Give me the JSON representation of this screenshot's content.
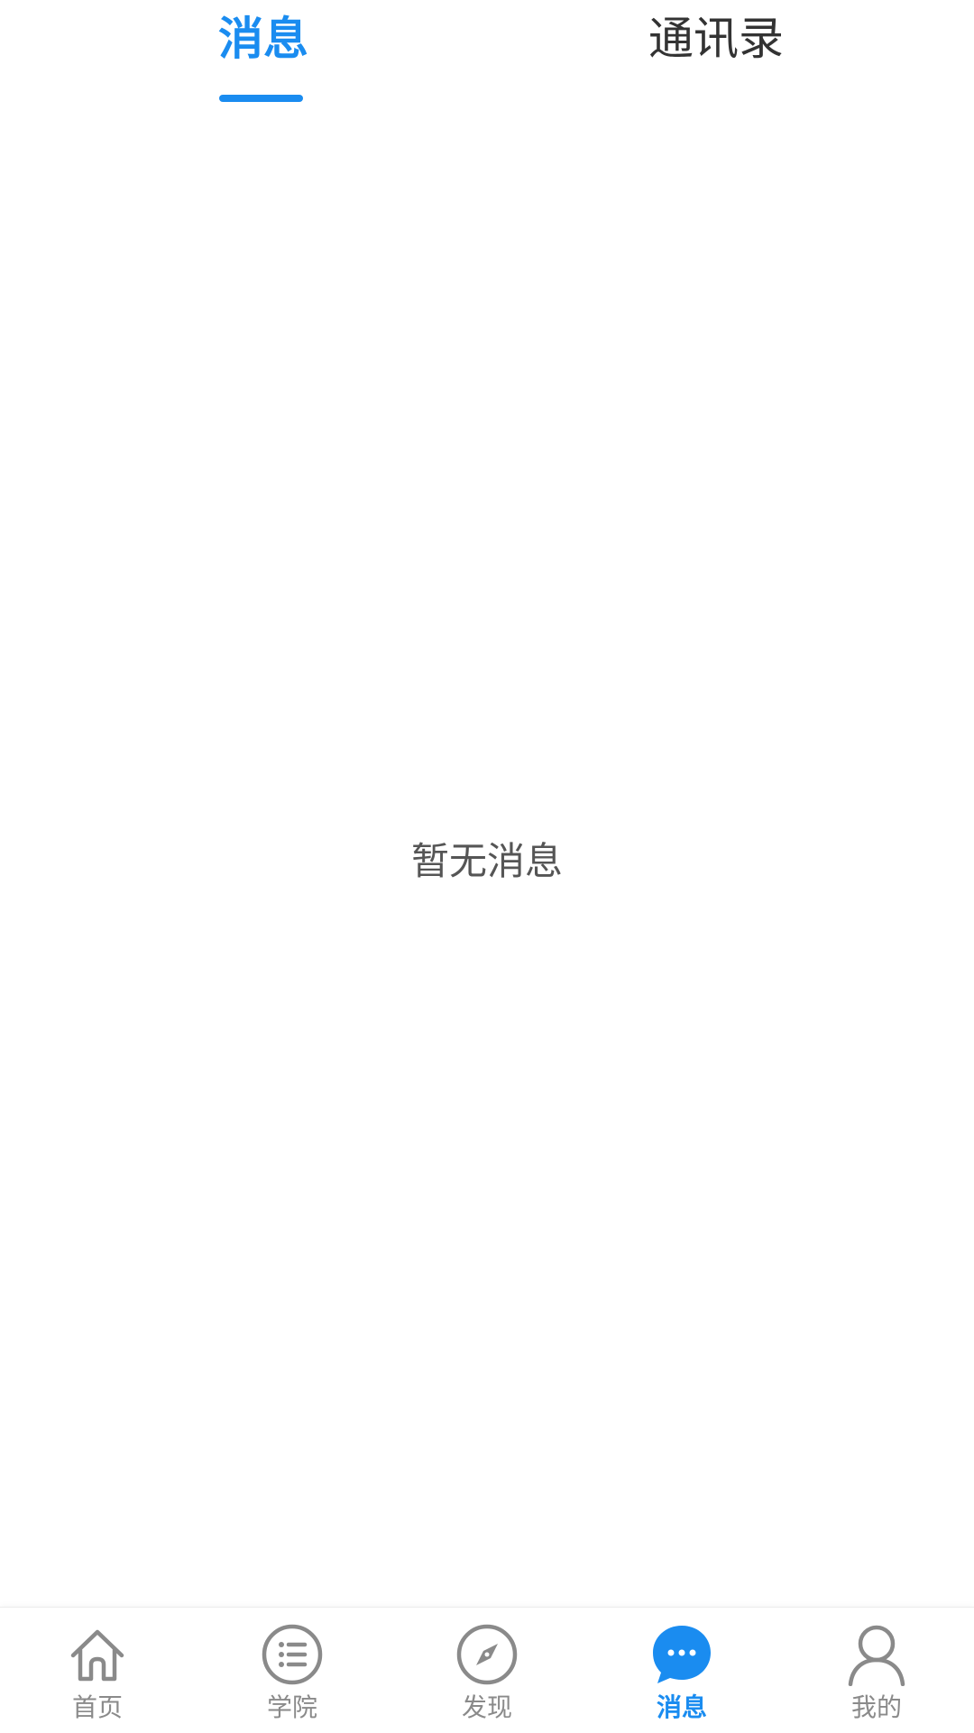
{
  "top_tabs": [
    {
      "label": "消息",
      "active": true
    },
    {
      "label": "通讯录",
      "active": false
    }
  ],
  "empty_state": {
    "text": "暂无消息"
  },
  "bottom_nav": {
    "items": [
      {
        "label": "首页",
        "icon": "home-icon",
        "active": false
      },
      {
        "label": "学院",
        "icon": "list-icon",
        "active": false
      },
      {
        "label": "发现",
        "icon": "compass-icon",
        "active": false
      },
      {
        "label": "消息",
        "icon": "chat-bubble-icon",
        "active": true
      },
      {
        "label": "我的",
        "icon": "user-icon",
        "active": false
      }
    ]
  },
  "colors": {
    "accent": "#1a8cf0",
    "inactive_text": "#8a8a8a",
    "icon_gray": "#8a8a8a",
    "body_text": "#555555"
  }
}
